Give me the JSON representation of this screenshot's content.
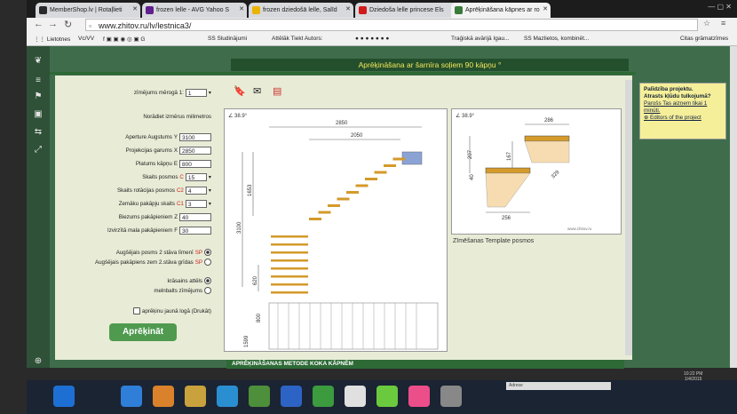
{
  "browser": {
    "tabs": [
      {
        "title": "MemberShop.lv | Rotaļlieti"
      },
      {
        "title": "frozen lelle - AVG Yahoo S"
      },
      {
        "title": "frozen dziedošā lelle, Salīd"
      },
      {
        "title": "Dziedoša lelle princese Els"
      },
      {
        "title": "Aprēķināšana kāpnes ar ro"
      }
    ],
    "url": "www.zhitov.ru/lv/lestnica3/",
    "bookmarks": [
      "Lietotnes",
      "Vc/VV",
      "SS Sludinājumi",
      "Attēlāk Tiekt Autors:",
      "Traģiskā avārijā Igau...",
      "SS Mazlietos, kombinēt...",
      "Citas grāmatzīmes"
    ]
  },
  "page": {
    "banner_title": "Aprēķināšana ar šarnīra soļiem 90 kāpņu °",
    "scale_label": "zīmējums mērogā 1:",
    "scale_value": "1",
    "note": "Norādiet izmērus milimetros",
    "fields": [
      {
        "label": "Aperture Augstums",
        "code": "Y",
        "value": "3100"
      },
      {
        "label": "Projekcijas garums",
        "code": "X",
        "value": "2850"
      },
      {
        "label": "Platums kāpņu",
        "code": "E",
        "value": "800"
      },
      {
        "label": "Skaits posmos",
        "code": "C",
        "value": "15"
      },
      {
        "label": "Skaits rotācijas posmos",
        "code": "C2",
        "value": "4"
      },
      {
        "label": "Zemāku pakāpju skaits",
        "code": "C1",
        "value": "3"
      },
      {
        "label": "Biezums pakāpieniem",
        "code": "Z",
        "value": "40"
      },
      {
        "label": "Izvirzītā mala pakāpieniem",
        "code": "F",
        "value": "30"
      }
    ],
    "radio_options": [
      {
        "label": "Augšējais posms 2 stāva līmenī",
        "code": "SP",
        "checked": true
      },
      {
        "label": "Augšējais pakāpiens zem 2.stāva grīdas",
        "code": "SP",
        "checked": false
      },
      {
        "label": "krāsains attēls",
        "code": "",
        "checked": true
      },
      {
        "label": "melnbalts zīmējums",
        "code": "",
        "checked": false
      }
    ],
    "checkbox_label": "aprēķinu jaunā logā (Drukāt)",
    "calc_button": "Aprēķināt",
    "drawing1": {
      "angle": "∠ 38.9°",
      "dims": [
        "2850",
        "2050",
        "1653",
        "3100",
        "620",
        "800",
        "1599"
      ]
    },
    "drawing2": {
      "angle": "∠ 38.9°",
      "dims": [
        "286",
        "207",
        "167",
        "40",
        "329",
        "256",
        "www.zhitov.ru"
      ]
    },
    "caption": "Zīmēšanas Template posmos",
    "help": {
      "line1": "Palīdzība projektu.",
      "line2": "Atrasts kļūdu tulkojumā?",
      "line3": "Parošs Tas aizņem tikai 1 minūti.",
      "line4": "Editors of the project"
    },
    "bottom_bar": "APRĒĶINĀŠANAS METODE KOKA KĀPNĒM"
  },
  "taskbar": {
    "address_label": "Adrese",
    "clock": [
      "10:22 PM",
      "1/4/2015"
    ]
  }
}
